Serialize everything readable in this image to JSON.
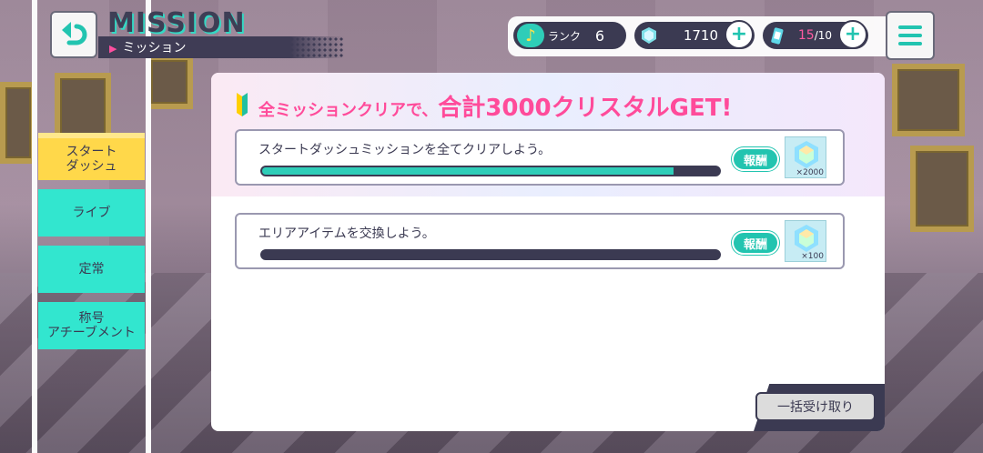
{
  "header": {
    "title_en": "MISSION",
    "title_jp": "ミッション"
  },
  "status": {
    "rank_label": "ランク",
    "rank_value": "6",
    "crystals": "1710",
    "stamina_current": "15",
    "stamina_max": "/10"
  },
  "tabs": [
    {
      "label": "スタート\nダッシュ",
      "selected": true
    },
    {
      "label": "ライブ",
      "selected": false
    },
    {
      "label": "定常",
      "selected": false
    },
    {
      "label": "称号\nアチーブメント",
      "selected": false
    }
  ],
  "banner": {
    "part1": "全ミッションクリアで、",
    "part2": "合計3000クリスタルGET",
    "part3": "!"
  },
  "missions": [
    {
      "text": "スタートダッシュミッションを全てクリアしよう。",
      "progress": 0.9,
      "reward_label": "報酬",
      "reward_qty": "×2000"
    },
    {
      "text": "エリアアイテムを交換しよう。",
      "progress": 0.0,
      "reward_label": "報酬",
      "reward_qty": "×100"
    }
  ],
  "bulk_button": "一括受け取り",
  "colors": {
    "accent_teal": "#2ecdb8",
    "accent_pink": "#ff4b9a",
    "tab_selected": "#ffd84a",
    "dark": "#3b3a52"
  },
  "icons": [
    "back-arrow-icon",
    "music-note-icon",
    "crystal-icon",
    "stamina-drink-icon",
    "plus-icon",
    "hamburger-menu-icon",
    "beginner-mark-icon"
  ]
}
